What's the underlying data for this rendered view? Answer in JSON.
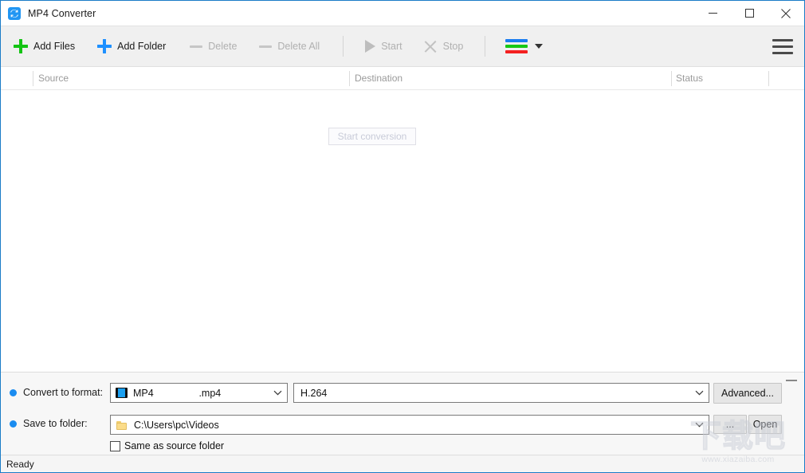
{
  "window": {
    "title": "MP4 Converter",
    "icon": "convert-icon",
    "accent": "#1a7cc7",
    "controls": {
      "minimize": "minimize-icon",
      "maximize": "maximize-icon",
      "close": "close-icon"
    }
  },
  "toolbar": {
    "items": [
      {
        "label": "Add Files",
        "icon": "plus-icon",
        "color": "#14c414",
        "enabled": true
      },
      {
        "label": "Add Folder",
        "icon": "plus-icon",
        "color": "#1e90ff",
        "enabled": true
      },
      {
        "label": "Delete",
        "icon": "minus-icon",
        "color": "#c6c6c6",
        "enabled": false
      },
      {
        "label": "Delete All",
        "icon": "minus-icon",
        "color": "#c6c6c6",
        "enabled": false
      },
      {
        "label": "Start",
        "icon": "play-icon",
        "color": "#bdbdbd",
        "enabled": false
      },
      {
        "label": "Stop",
        "icon": "x-icon",
        "color": "#c2c2c2",
        "enabled": false
      }
    ],
    "presets": {
      "icon": "color-bars-icon",
      "bars": [
        "#1a7cf0",
        "#16c816",
        "#f42020"
      ],
      "dropdown": "chevron-down-icon"
    },
    "menu": "hamburger-menu-icon"
  },
  "tooltip": {
    "text": "Start conversion",
    "visible": true
  },
  "file_list": {
    "columns": [
      {
        "label": "Source"
      },
      {
        "label": "Destination"
      },
      {
        "label": "Status"
      }
    ],
    "rows": []
  },
  "settings": {
    "collapse": "collapse-handle",
    "format": {
      "label": "Convert to format:",
      "bullet_color": "#1a8cf0",
      "value": "MP4",
      "extension": ".mp4",
      "icon": "film-icon",
      "dropdown": "chevron-down-icon"
    },
    "codec": {
      "value": "H.264",
      "dropdown": "chevron-down-icon"
    },
    "advanced_button": "Advanced...",
    "save": {
      "label": "Save to folder:",
      "bullet_color": "#1a8cf0",
      "value": "C:\\Users\\pc\\Videos",
      "icon": "folder-icon",
      "dropdown": "chevron-down-icon"
    },
    "browse_button": "...",
    "open_button": "Open",
    "same_as_source": {
      "label": "Same as source folder",
      "checked": false
    }
  },
  "statusbar": {
    "text": "Ready"
  },
  "watermark": {
    "text": "下载吧",
    "url": "www.xiazaiba.com"
  }
}
